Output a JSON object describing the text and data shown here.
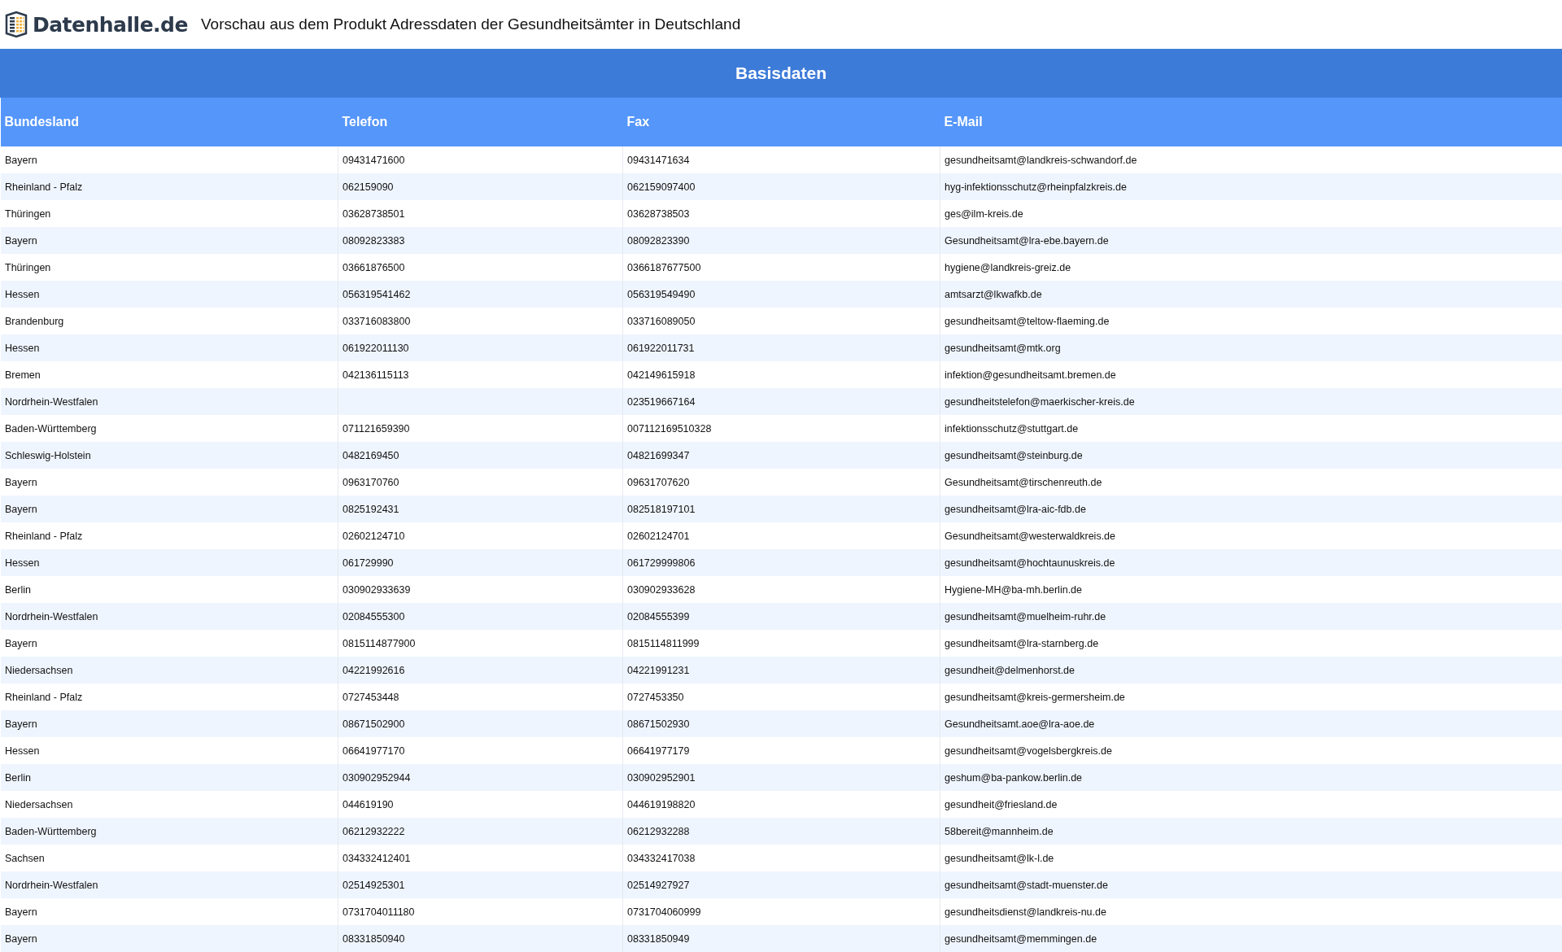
{
  "header": {
    "logo": "Datenhalle.de",
    "title": "Vorschau aus dem Produkt Adressdaten der Gesundheitsämter in Deutschland"
  },
  "table": {
    "caption": "Basisdaten",
    "columns": [
      "Bundesland",
      "Telefon",
      "Fax",
      "E-Mail"
    ],
    "rows": [
      [
        "Bayern",
        "09431471600",
        "09431471634",
        "gesundheitsamt@landkreis-schwandorf.de"
      ],
      [
        "Rheinland - Pfalz",
        "062159090",
        "062159097400",
        "hyg-infektionsschutz@rheinpfalzkreis.de"
      ],
      [
        "Thüringen",
        "03628738501",
        "03628738503",
        "ges@ilm-kreis.de"
      ],
      [
        "Bayern",
        "08092823383",
        "08092823390",
        "Gesundheitsamt@lra-ebe.bayern.de"
      ],
      [
        "Thüringen",
        "03661876500",
        "0366187677500",
        "hygiene@landkreis-greiz.de"
      ],
      [
        "Hessen",
        "056319541462",
        "056319549490",
        "amtsarzt@lkwafkb.de"
      ],
      [
        "Brandenburg",
        "033716083800",
        "033716089050",
        "gesundheitsamt@teltow-flaeming.de"
      ],
      [
        "Hessen",
        "061922011130",
        "061922011731",
        "gesundheitsamt@mtk.org"
      ],
      [
        "Bremen",
        "042136115113",
        "042149615918",
        "infektion@gesundheitsamt.bremen.de"
      ],
      [
        "Nordrhein-Westfalen",
        "",
        "023519667164",
        "gesundheitstelefon@maerkischer-kreis.de"
      ],
      [
        "Baden-Württemberg",
        "071121659390",
        "007112169510328",
        "infektionsschutz@stuttgart.de"
      ],
      [
        "Schleswig-Holstein",
        "0482169450",
        "04821699347",
        "gesundheitsamt@steinburg.de"
      ],
      [
        "Bayern",
        "0963170760",
        "09631707620",
        "Gesundheitsamt@tirschenreuth.de"
      ],
      [
        "Bayern",
        "0825192431",
        "082518197101",
        "gesundheitsamt@lra-aic-fdb.de"
      ],
      [
        "Rheinland - Pfalz",
        "02602124710",
        "02602124701",
        "Gesundheitsamt@westerwaldkreis.de"
      ],
      [
        "Hessen",
        "061729990",
        "061729999806",
        "gesundheitsamt@hochtaunuskreis.de"
      ],
      [
        "Berlin",
        "030902933639",
        "030902933628",
        "Hygiene-MH@ba-mh.berlin.de"
      ],
      [
        "Nordrhein-Westfalen",
        "02084555300",
        "02084555399",
        "gesundheitsamt@muelheim-ruhr.de"
      ],
      [
        "Bayern",
        "0815114877900",
        "0815114811999",
        "gesundheitsamt@lra-starnberg.de"
      ],
      [
        "Niedersachsen",
        "04221992616",
        "04221991231",
        "gesundheit@delmenhorst.de"
      ],
      [
        "Rheinland - Pfalz",
        "0727453448",
        "0727453350",
        "gesundheitsamt@kreis-germersheim.de"
      ],
      [
        "Bayern",
        "08671502900",
        "08671502930",
        "Gesundheitsamt.aoe@lra-aoe.de"
      ],
      [
        "Hessen",
        "06641977170",
        "06641977179",
        "gesundheitsamt@vogelsbergkreis.de"
      ],
      [
        "Berlin",
        "030902952944",
        "030902952901",
        "geshum@ba-pankow.berlin.de"
      ],
      [
        "Niedersachsen",
        "044619190",
        "044619198820",
        "gesundheit@friesland.de"
      ],
      [
        "Baden-Württemberg",
        "06212932222",
        "06212932288",
        "58bereit@mannheim.de"
      ],
      [
        "Sachsen",
        "034332412401",
        "034332417038",
        "gesundheitsamt@lk-l.de"
      ],
      [
        "Nordrhein-Westfalen",
        "02514925301",
        "02514927927",
        "gesundheitsamt@stadt-muenster.de"
      ],
      [
        "Bayern",
        "0731704011180",
        "0731704060999",
        "gesundheitsdienst@landkreis-nu.de"
      ],
      [
        "Bayern",
        "08331850940",
        "08331850949",
        "gesundheitsamt@memmingen.de"
      ]
    ]
  }
}
